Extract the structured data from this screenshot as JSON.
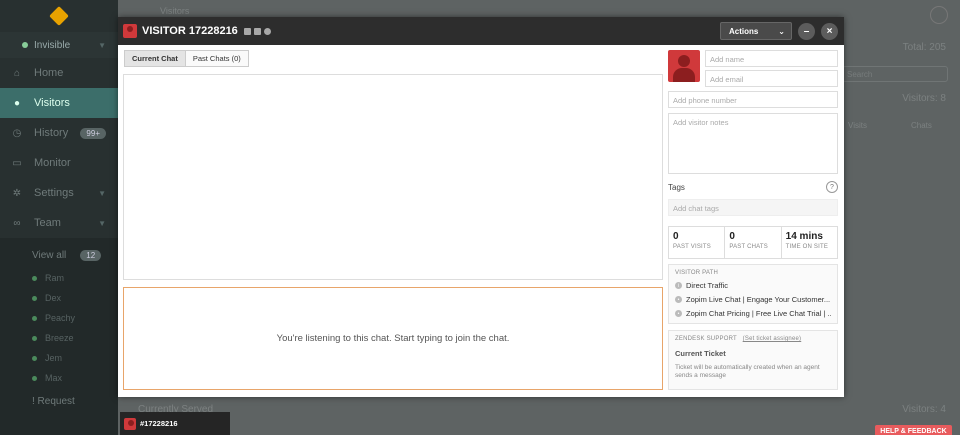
{
  "sidebar": {
    "status": "Invisible",
    "items": [
      {
        "label": "Home",
        "icon": "home-icon"
      },
      {
        "label": "Visitors",
        "icon": "visitors-icon",
        "active": true
      },
      {
        "label": "History",
        "icon": "history-icon",
        "badge": "99+"
      },
      {
        "label": "Monitor",
        "icon": "monitor-icon"
      },
      {
        "label": "Settings",
        "icon": "gear-icon"
      },
      {
        "label": "Team",
        "icon": "team-icon"
      }
    ],
    "team_view": {
      "label": "View all",
      "badge": "12"
    },
    "team_members": [
      "Ram",
      "Dex",
      "Peachy",
      "Breeze",
      "Jem",
      "Max"
    ],
    "requests": "! Request"
  },
  "background": {
    "page_title": "Visitors",
    "total": "Total: 205",
    "search_placeholder": "Search",
    "visitors_count": "Visitors: 8",
    "col_visits": "Visits",
    "col_chats": "Chats",
    "served_label": "Currently Served",
    "served_count": "Visitors: 4"
  },
  "modal": {
    "title": "VISITOR 17228216",
    "actions_label": "Actions",
    "minimize_label": "–",
    "close_label": "×",
    "tabs": [
      "Current Chat",
      "Past Chats (0)"
    ],
    "compose_message": "You're listening to this chat. Start typing to join the chat.",
    "profile": {
      "name_placeholder": "Add name",
      "email_placeholder": "Add email",
      "phone_placeholder": "Add phone number",
      "notes_placeholder": "Add visitor notes",
      "tags_label": "Tags",
      "tags_help": "?",
      "tags_placeholder": "Add chat tags"
    },
    "stats": [
      {
        "value": "0",
        "caption": "PAST VISITS"
      },
      {
        "value": "0",
        "caption": "PAST CHATS"
      },
      {
        "value": "14 mins",
        "caption": "TIME ON SITE"
      }
    ],
    "visitor_path": {
      "header": "VISITOR PATH",
      "items": [
        "Direct Traffic",
        "Zopim Live Chat | Engage Your Customer...",
        "Zopim Chat Pricing | Free Live Chat Trial | ..."
      ]
    },
    "zendesk": {
      "header": "ZENDESK SUPPORT",
      "link": "(Set ticket assignee)",
      "current_ticket": "Current Ticket",
      "description": "Ticket will be automatically created when an agent sends a message"
    }
  },
  "chat_tab": {
    "label": "#17228216"
  },
  "help_button": "HELP & FEEDBACK"
}
